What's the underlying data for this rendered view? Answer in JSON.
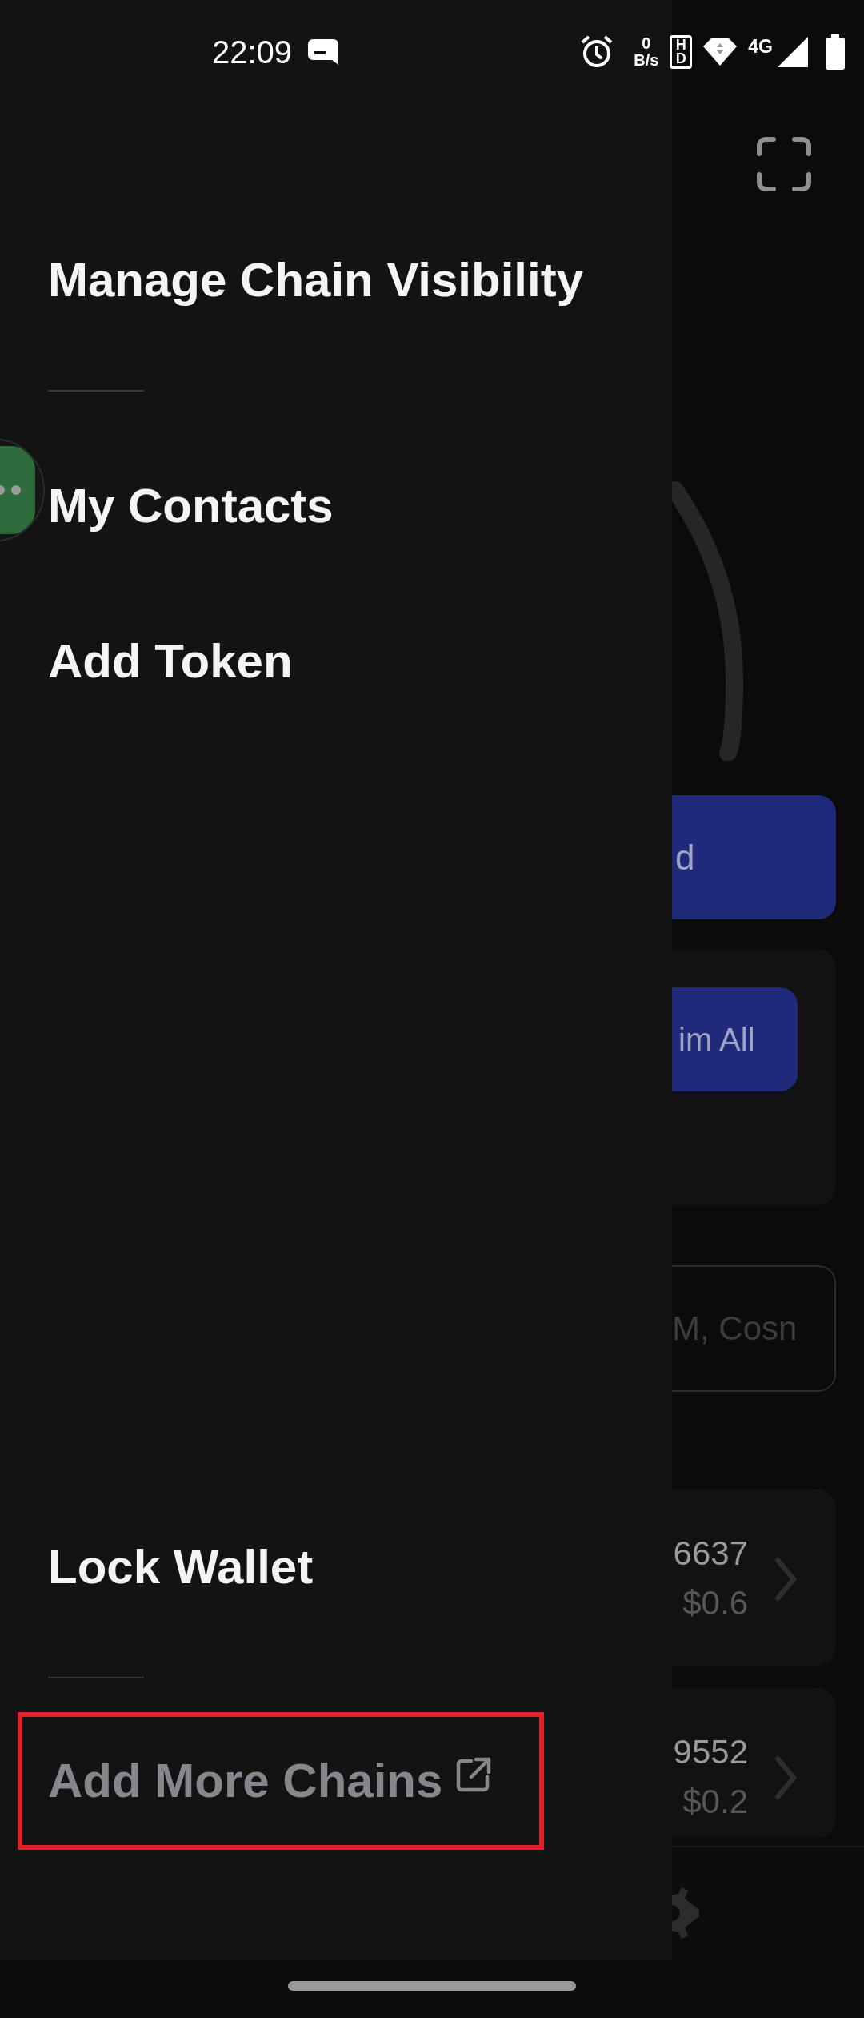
{
  "status_bar": {
    "time": "22:09",
    "network_speed": "0",
    "network_speed_unit": "B/s",
    "hd_badge": "HD",
    "network_type": "4G"
  },
  "background_screen": {
    "primary_button": {
      "label": "d"
    },
    "claim_button": {
      "label": "im All"
    },
    "search": {
      "placeholder": "M, Cosn"
    },
    "tokens": [
      {
        "amount": "6637",
        "value": "$0.6"
      },
      {
        "amount": "9552",
        "value": "$0.2"
      }
    ]
  },
  "drawer": {
    "header_item": {
      "label": "Manage Chain Visibility"
    },
    "items": [
      {
        "label": "My Contacts"
      },
      {
        "label": "Add Token"
      }
    ],
    "footer_item": {
      "label": "Lock Wallet"
    },
    "external_link": {
      "label": "Add More Chains",
      "highlighted": true
    }
  }
}
